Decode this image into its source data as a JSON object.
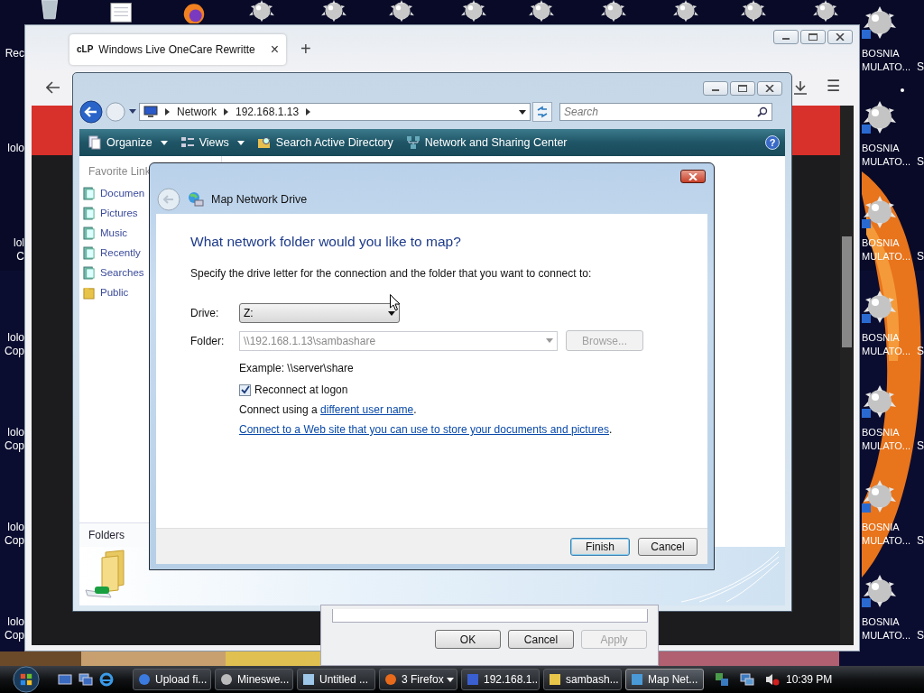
{
  "desktop": {
    "left_icons": [
      {
        "lines": [
          "Rec"
        ]
      },
      {
        "lines": [
          "lolo"
        ]
      },
      {
        "lines": [
          "lol",
          "C"
        ]
      },
      {
        "lines": [
          "lolo",
          "Cop"
        ]
      },
      {
        "lines": [
          "lolo",
          "Cop"
        ]
      },
      {
        "lines": [
          "lolo",
          "Cop"
        ]
      },
      {
        "lines": [
          "lolo",
          "Cop"
        ]
      }
    ],
    "right_icons": [
      {
        "lines": [
          "BOSNIA",
          "MULATO..."
        ]
      },
      {
        "lines": [
          "BOSNIA",
          "MULATO..."
        ]
      },
      {
        "lines": [
          "BOSNIA",
          "MULATO..."
        ]
      },
      {
        "lines": [
          "BOSNIA",
          "MULATO..."
        ]
      },
      {
        "lines": [
          "BOSNIA",
          "MULATO..."
        ]
      },
      {
        "lines": [
          "BOSNIA",
          "MULATO..."
        ]
      },
      {
        "lines": [
          "BOSNIA",
          "MULATO..."
        ]
      }
    ],
    "column_3_labels": [
      "S",
      "S",
      "S",
      "S",
      "S",
      "S",
      "S"
    ]
  },
  "browser": {
    "tab": {
      "favicon": "cLP",
      "title": "Windows Live OneCare Rewritte",
      "close": "×"
    },
    "new_tab": "+",
    "menu": "☰"
  },
  "explorer": {
    "address": [
      "Network",
      "192.168.1.13"
    ],
    "search": {
      "placeholder": "Search"
    },
    "toolbar": [
      {
        "label": "Organize",
        "dropdown": true,
        "kind": "organize"
      },
      {
        "label": "Views",
        "dropdown": true,
        "kind": "views"
      },
      {
        "label": "Search Active Directory",
        "dropdown": false,
        "kind": "directory"
      },
      {
        "label": "Network and Sharing Center",
        "dropdown": false,
        "kind": "network"
      }
    ],
    "help": "?",
    "favorite_links": {
      "title": "Favorite Link",
      "items": [
        {
          "label": "Documen",
          "kind": "library"
        },
        {
          "label": "Pictures",
          "kind": "library"
        },
        {
          "label": "Music",
          "kind": "library"
        },
        {
          "label": "Recently",
          "kind": "library"
        },
        {
          "label": "Searches",
          "kind": "library"
        },
        {
          "label": "Public",
          "kind": "folder"
        }
      ]
    },
    "folders_label": "Folders"
  },
  "dialog": {
    "title": "Map Network Drive",
    "heading": "What network folder would you like to map?",
    "instruction": "Specify the drive letter for the connection and the folder that you want to connect to:",
    "drive": {
      "label": "Drive:",
      "value": "Z:"
    },
    "folder": {
      "label": "Folder:",
      "value": "\\\\192.168.1.13\\sambashare",
      "disabled": true
    },
    "browse": {
      "label": "Browse...",
      "disabled": true
    },
    "example": "Example: \\\\server\\share",
    "reconnect": {
      "label": "Reconnect at logon",
      "checked": true
    },
    "connect": {
      "text": "Connect using a ",
      "link": "different user name",
      "end": "."
    },
    "web": {
      "link": "Connect to a Web site that you can use to store your documents and pictures",
      "end": "."
    },
    "buttons": [
      {
        "label": "Finish",
        "default": true
      },
      {
        "label": "Cancel",
        "default": false
      }
    ]
  },
  "properties_dialog": {
    "buttons": [
      {
        "label": "OK",
        "disabled": false
      },
      {
        "label": "Cancel",
        "disabled": false
      },
      {
        "label": "Apply",
        "disabled": true
      }
    ]
  },
  "taskbar": {
    "tasks": [
      {
        "label": "Upload fi...",
        "kind": "chrome",
        "selected": false,
        "dropdown": false
      },
      {
        "label": "Mineswe...",
        "kind": "mine",
        "selected": false,
        "dropdown": false
      },
      {
        "label": "Untitled ...",
        "kind": "notepad",
        "selected": false,
        "dropdown": false
      },
      {
        "label": "3 Firefox",
        "kind": "firefox",
        "selected": false,
        "dropdown": true
      },
      {
        "label": "192.168.1...",
        "kind": "computer",
        "selected": false,
        "dropdown": false
      },
      {
        "label": "sambash...",
        "kind": "folder",
        "selected": false,
        "dropdown": false
      },
      {
        "label": "Map Net...",
        "kind": "network",
        "selected": true,
        "dropdown": false
      }
    ],
    "clock": "10:39 PM"
  }
}
